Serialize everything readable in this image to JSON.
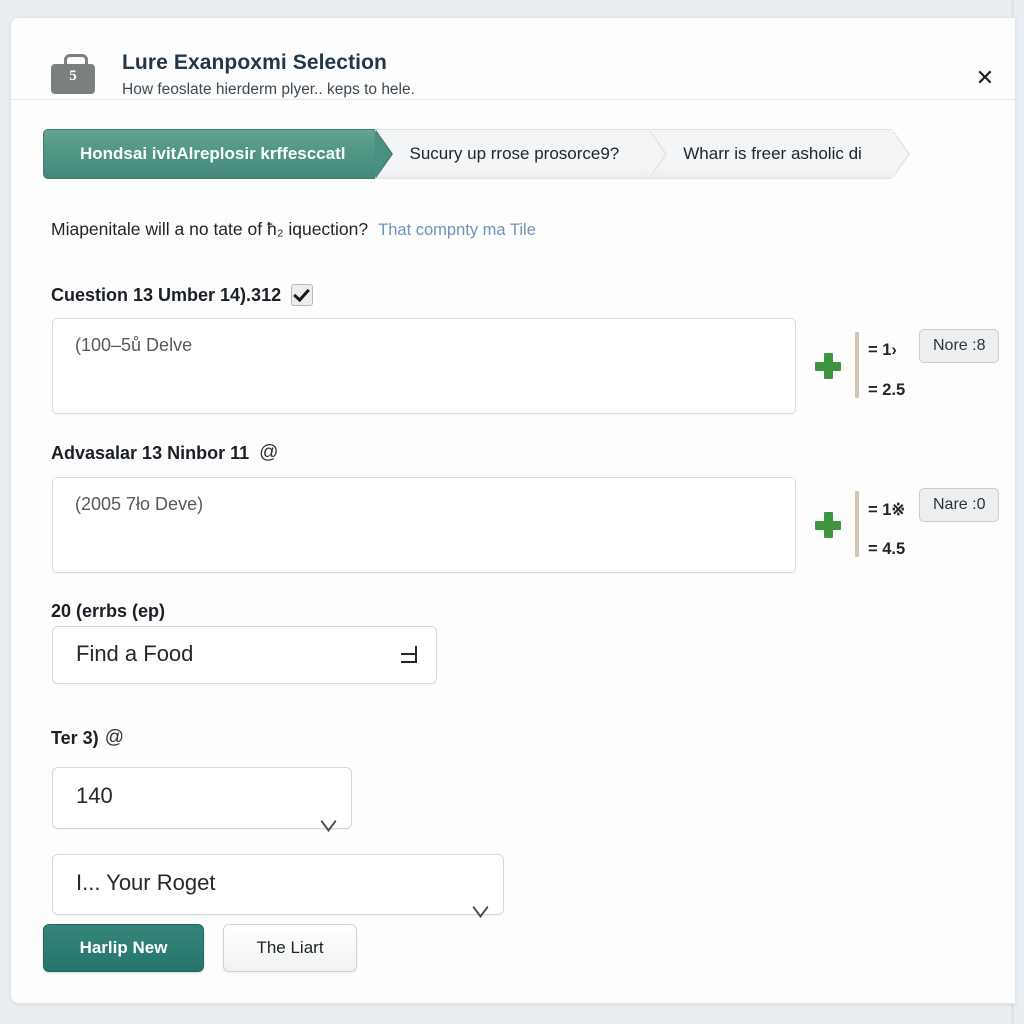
{
  "header": {
    "icon": "briefcase-icon",
    "badge_count": "5",
    "title": "Lure Exanpoxmi Selection",
    "subtitle": "How feoslate hierderm plyer.. keps to hele.",
    "close_icon": "✕"
  },
  "tabs": [
    {
      "label": "Hondsai ivitAlreplosir krffesccatl",
      "active": true
    },
    {
      "label": "Sucury up rrose prosorce9?",
      "active": false
    },
    {
      "label": "Wharr is freer asholic di",
      "active": false
    }
  ],
  "question": {
    "text": "Miapenitale will a no tate of ħ₂ iquection?",
    "link": "That compnty ma Tile"
  },
  "fields": [
    {
      "label": "Cuestion 13 Umber 14).312",
      "has_checkbox": true,
      "checked": true,
      "value": "(100–5ů Delve",
      "plus_icon": "plus-icon",
      "eq_first": "= 1›",
      "eq_second": "= 2.5",
      "pill": "Nore :8"
    },
    {
      "label": "Advasalar 13 Ninbor 11",
      "at_icon": "@",
      "has_checkbox": false,
      "value": "(2005 7ło Deve)",
      "plus_icon": "plus-icon",
      "eq_first": "= 1※",
      "eq_second": "= 4.5",
      "pill": "Nare :0"
    }
  ],
  "food_select": {
    "label": "20 (errbs (ep)",
    "value": "Find a Food",
    "icon": "double-chevron-down-icon"
  },
  "amount_select": {
    "label": "Ter 3)",
    "at_icon": "@",
    "value": "140",
    "icon": "chevron-down-icon"
  },
  "unit_select": {
    "value": "I... Your Roget",
    "icon": "chevron-down-icon"
  },
  "actions": {
    "primary": "Harlip New",
    "secondary": "The Liart"
  },
  "colors": {
    "accent": "#4e9383",
    "primary_button": "#24756c",
    "link": "#6f93bb",
    "plus": "#3f9440",
    "page_bg": "#e9eef3"
  }
}
